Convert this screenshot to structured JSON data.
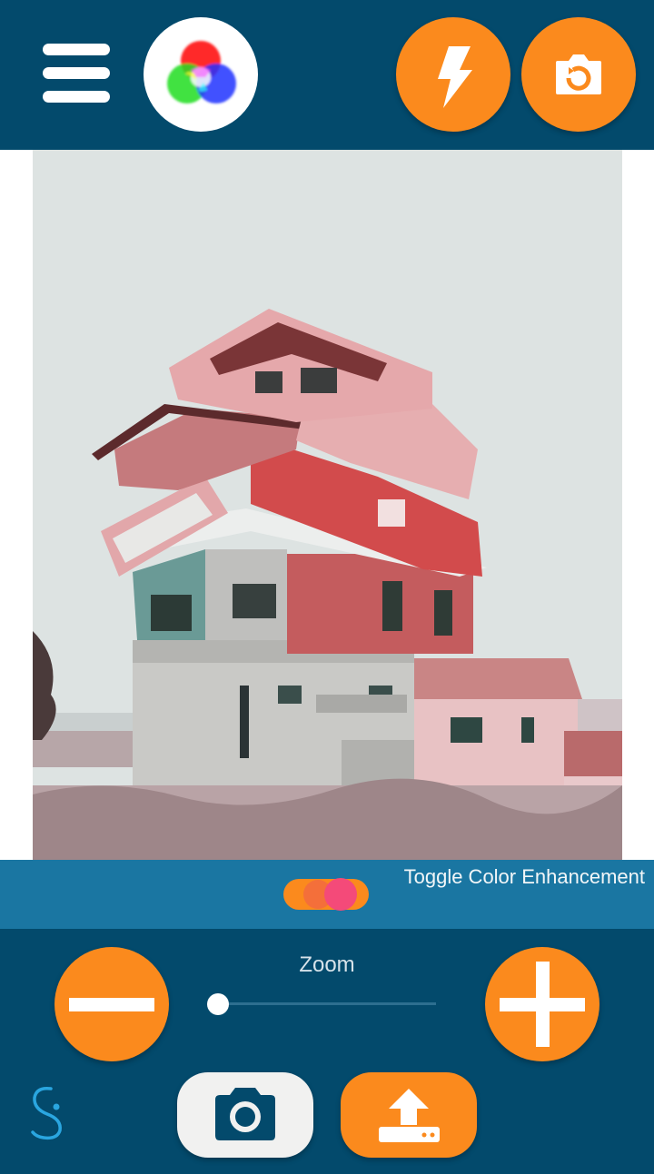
{
  "header": {
    "menu_icon": "hamburger-menu-icon",
    "color_icon": "rgb-color-circles-icon",
    "flash_icon": "lightning-bolt-icon",
    "rotate_icon": "camera-switch-icon"
  },
  "viewer": {
    "image": "stacked-houses-collage-photo"
  },
  "enhancement": {
    "label": "Toggle Color Enhancement",
    "enabled": true
  },
  "zoom": {
    "label": "Zoom",
    "level": 0,
    "minus_icon": "minus-icon",
    "plus_icon": "plus-icon"
  },
  "footer": {
    "logo_icon": "s-logo-icon",
    "camera_icon": "camera-icon",
    "upload_icon": "upload-tray-icon"
  },
  "colors": {
    "header_bg": "#034a6c",
    "accent_orange": "#fb8a1d",
    "toggle_bar_bg": "#1a76a2",
    "toggle_knob": "#f44a79"
  }
}
